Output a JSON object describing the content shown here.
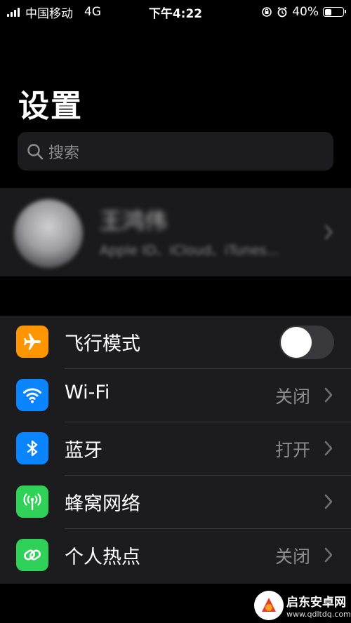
{
  "status_bar": {
    "carrier": "中国移动",
    "network": "4G",
    "time": "下午4:22",
    "battery_percent": "40%",
    "battery_level": 0.4
  },
  "header": {
    "title": "设置"
  },
  "search": {
    "placeholder": "搜索"
  },
  "profile": {
    "name": "王鸿伟",
    "subtitle": "Apple ID、iCloud、iTunes..."
  },
  "settings": [
    {
      "label": "飞行模式",
      "value": "",
      "icon": "airplane-icon",
      "color": "#ff9500",
      "toggle": false
    },
    {
      "label": "Wi-Fi",
      "value": "关闭",
      "icon": "wifi-icon",
      "color": "#0a84ff"
    },
    {
      "label": "蓝牙",
      "value": "打开",
      "icon": "bluetooth-icon",
      "color": "#0a84ff"
    },
    {
      "label": "蜂窝网络",
      "value": "",
      "icon": "cellular-antenna-icon",
      "color": "#30d158"
    },
    {
      "label": "个人热点",
      "value": "关闭",
      "icon": "hotspot-link-icon",
      "color": "#30d158"
    }
  ],
  "watermark": {
    "title": "启东安卓网",
    "url": "www.qdltdq.com"
  }
}
